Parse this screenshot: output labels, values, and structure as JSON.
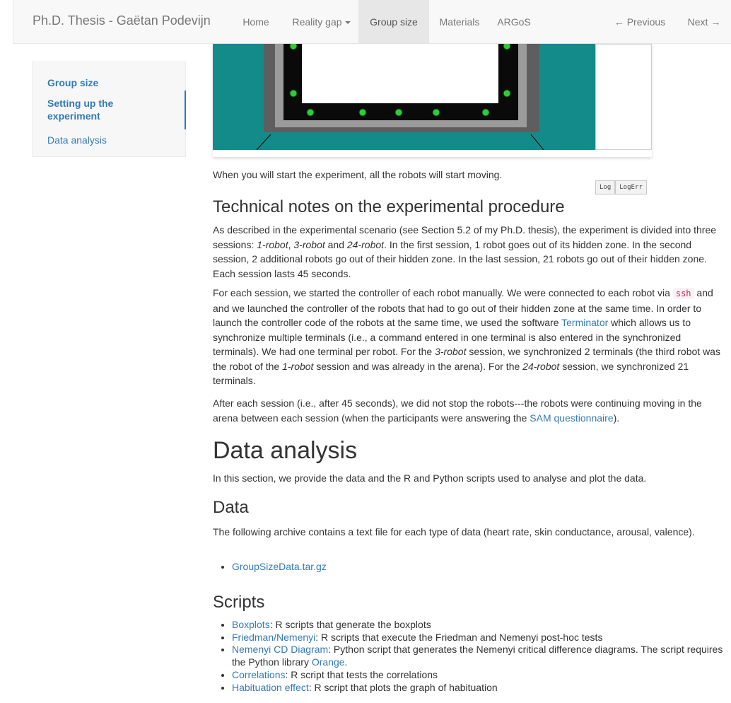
{
  "navbar": {
    "brand": "Ph.D. Thesis - Gaëtan Podevijn",
    "home": "Home",
    "reality_gap": "Reality gap",
    "group_size": "Group size",
    "materials": "Materials",
    "argos": "ARGoS",
    "previous": "Previous",
    "next": "Next"
  },
  "sidebar": {
    "group_size": "Group size",
    "setting_up": "Setting up the experiment",
    "data_analysis": "Data analysis"
  },
  "simulator": {
    "tab_log": "Log",
    "tab_logerr": "LogErr"
  },
  "content": {
    "intro": "When you will start the experiment, all the robots will start moving.",
    "tech_heading": "Technical notes on the experimental procedure",
    "p1": {
      "a": "As described in the experimental scenario (see Section 5.2 of my Ph.D. thesis), the experiment is divided into three sessions: ",
      "robot1": "1-robot",
      "sep1": ", ",
      "robot3": "3-robot",
      "and": " and ",
      "robot24": "24-robot",
      "b": ". In the first session, 1 robot goes out of its hidden zone. In the second session, 2 additional robots go out of their hidden zone. In the last session, 21 robots go out of their hidden zone. Each session lasts 45 seconds."
    },
    "p2": {
      "a": "For each session, we started the controller of each robot manually. We were connected to each robot via ",
      "code": "ssh",
      "b": " and and we launched the controller of the robots that had to go out of their hidden zone at the same time. In order to launch the controller code of the robots at the same time, we used the software ",
      "link": "Terminator",
      "c": " which allows us to synchronize multiple terminals (i.e., a command entered in one terminal is also entered in the synchronized terminals). We had one terminal per robot. For the ",
      "robot3": "3-robot",
      "d": " session, we synchronized 2 terminals (the third robot was the robot of the ",
      "robot1": "1-robot",
      "e": " session and was already in the arena). For the ",
      "robot24": "24-robot",
      "f": " session, we synchronized 21 terminals."
    },
    "p3": {
      "a": "After each session (i.e., after 45 seconds), we did not stop the robots---the robots were continuing moving in the arena between each session (when the participants were answering the ",
      "link": "SAM questionnaire",
      "b": ")."
    },
    "data_analysis_heading": "Data analysis",
    "data_analysis_text": "In this section, we provide the data and the R and Python scripts used to analyse and plot the data.",
    "data_heading": "Data",
    "data_text": "The following archive contains a text file for each type of data (heart rate, skin conductance, arousal, valence).",
    "data_link": "GroupSizeData.tar.gz",
    "scripts_heading": "Scripts",
    "scripts": [
      {
        "link": "Boxplots",
        "text": ": R scripts that generate the boxplots"
      },
      {
        "link": "Friedman/Nemenyi",
        "text": ": R scripts that execute the Friedman and Nemenyi post-hoc tests"
      },
      {
        "link": "Nemenyi CD Diagram",
        "text": ": Python script that generates the Nemenyi critical difference diagrams. The script requires the Python library ",
        "link2": "Orange",
        "text2": "."
      },
      {
        "link": "Correlations",
        "text": ": R script that tests the correlations"
      },
      {
        "link": "Habituation effect",
        "text": ": R script that plots the graph of habituation"
      }
    ]
  },
  "colors": {
    "link": "#337ab7",
    "arena_teal": "#138b8b",
    "arena_wall": "#8d8d8d",
    "robot_green": "#2fcc3a"
  }
}
